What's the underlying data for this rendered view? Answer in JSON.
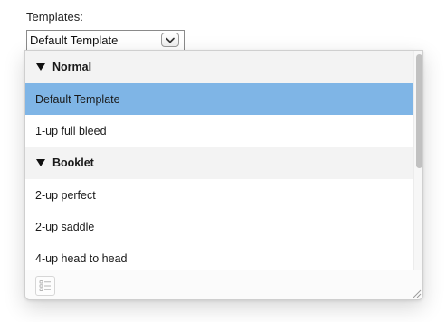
{
  "field": {
    "label": "Templates:",
    "selected_value": "Default Template"
  },
  "popup": {
    "groups": [
      {
        "label": "Normal",
        "items": [
          {
            "label": "Default Template",
            "selected": true
          },
          {
            "label": "1-up full bleed",
            "selected": false
          }
        ]
      },
      {
        "label": "Booklet",
        "items": [
          {
            "label": "2-up perfect",
            "selected": false
          },
          {
            "label": "2-up saddle",
            "selected": false
          },
          {
            "label": "4-up head to head",
            "selected": false
          }
        ]
      }
    ]
  },
  "colors": {
    "selection": "#7fb5e6",
    "group_header_bg": "#f3f3f3"
  },
  "icons": {
    "dropdown": "chevron-down-icon",
    "group_toggle": "disclosure-triangle-down-icon",
    "footer_button": "list-view-icon",
    "resize": "resize-grip-icon"
  }
}
